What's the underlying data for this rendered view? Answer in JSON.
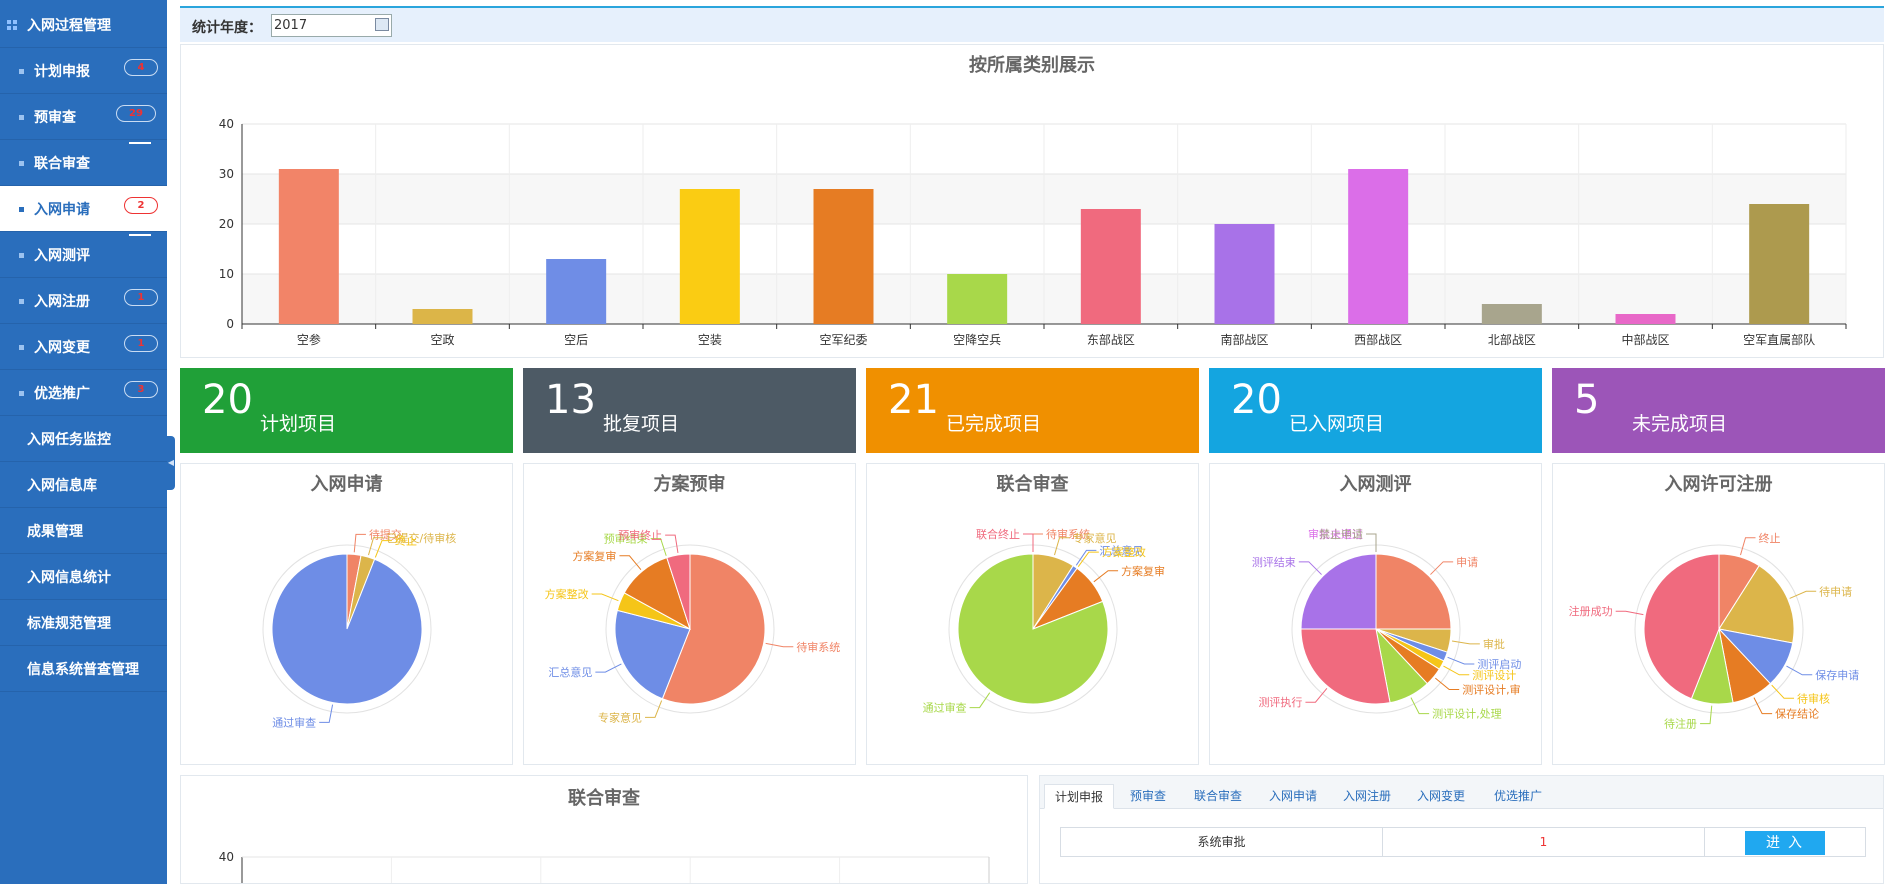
{
  "sidebar": {
    "items": [
      {
        "label": "入网过程管理",
        "kind": "top",
        "icon": "grid-icon"
      },
      {
        "label": "计划申报",
        "kind": "sub",
        "badge": "4"
      },
      {
        "label": "预审查",
        "kind": "sub",
        "badge": "29"
      },
      {
        "label": "联合审查",
        "kind": "sub",
        "badge": ""
      },
      {
        "label": "入网申请",
        "kind": "sub",
        "badge": "2",
        "active": true
      },
      {
        "label": "入网测评",
        "kind": "sub",
        "badge": ""
      },
      {
        "label": "入网注册",
        "kind": "sub",
        "badge": "1"
      },
      {
        "label": "入网变更",
        "kind": "sub",
        "badge": "1"
      },
      {
        "label": "优选推广",
        "kind": "sub",
        "badge": "3"
      },
      {
        "label": "入网任务监控",
        "kind": "top"
      },
      {
        "label": "入网信息库",
        "kind": "top"
      },
      {
        "label": "成果管理",
        "kind": "top"
      },
      {
        "label": "入网信息统计",
        "kind": "top"
      },
      {
        "label": "标准规范管理",
        "kind": "top"
      },
      {
        "label": "信息系统普查管理",
        "kind": "top"
      }
    ]
  },
  "filter": {
    "year_label": "统计年度：",
    "year_value": "2017"
  },
  "bar_chart_title": "按所属类别展示",
  "stats": [
    {
      "num": "20",
      "label": "计划项目",
      "color": "#20a038"
    },
    {
      "num": "13",
      "label": "批复项目",
      "color": "#4d5a65"
    },
    {
      "num": "21",
      "label": "已完成项目",
      "color": "#f09000"
    },
    {
      "num": "20",
      "label": "已入网项目",
      "color": "#14a5e0"
    },
    {
      "num": "5",
      "label": "未完成项目",
      "color": "#9c55b8"
    }
  ],
  "bottom_chart_title": "联合审查",
  "tabs": [
    "计划申报",
    "预审查",
    "联合审查",
    "入网申请",
    "入网注册",
    "入网变更",
    "优选推广"
  ],
  "table_row": {
    "name": "系统审批",
    "count": "1",
    "action": "进入"
  },
  "chart_data": [
    {
      "type": "bar",
      "title": "按所属类别展示",
      "categories": [
        "空参",
        "空政",
        "空后",
        "空装",
        "空军纪委",
        "空降空兵",
        "东部战区",
        "南部战区",
        "西部战区",
        "北部战区",
        "中部战区",
        "空军直属部队"
      ],
      "values": [
        31,
        3,
        13,
        27,
        27,
        10,
        23,
        20,
        31,
        4,
        2,
        24
      ],
      "colors": [
        "#f28468",
        "#dcb548",
        "#6f8de6",
        "#facc13",
        "#e67c23",
        "#a8d84a",
        "#f06a7e",
        "#a872e8",
        "#db6ee8",
        "#a8a58d",
        "#e868c8",
        "#ad9a4e"
      ],
      "ylim": [
        0,
        40
      ],
      "yticks": [
        0,
        10,
        20,
        30,
        40
      ]
    },
    {
      "type": "pie",
      "title": "入网申请",
      "slices": [
        {
          "label": "待提交",
          "value": 3,
          "color": "#f08466"
        },
        {
          "label": "已提交/待审核",
          "value": 3,
          "color": "#dcb54a"
        },
        {
          "label": "终止",
          "value": 0,
          "color": "#f5c518"
        },
        {
          "label": "通过审查",
          "value": 94,
          "color": "#6e8de6"
        }
      ]
    },
    {
      "type": "pie",
      "title": "方案预审",
      "slices": [
        {
          "label": "待审系统",
          "value": 56,
          "color": "#f08466"
        },
        {
          "label": "专家意见",
          "value": 0,
          "color": "#dcb54a"
        },
        {
          "label": "汇总意见",
          "value": 23,
          "color": "#6e8de6"
        },
        {
          "label": "方案整改",
          "value": 4,
          "color": "#f5c518"
        },
        {
          "label": "方案复审",
          "value": 12,
          "color": "#e67c23"
        },
        {
          "label": "预审结束",
          "value": 0,
          "color": "#a8d84a"
        },
        {
          "label": "预审终止",
          "value": 5,
          "color": "#f06a7e"
        }
      ]
    },
    {
      "type": "pie",
      "title": "联合审查",
      "slices": [
        {
          "label": "待审系统",
          "value": 0,
          "color": "#f08466"
        },
        {
          "label": "专家意见",
          "value": 9,
          "color": "#dcb54a"
        },
        {
          "label": "汇总意见",
          "value": 1,
          "color": "#6e8de6"
        },
        {
          "label": "方案整改",
          "value": 0,
          "color": "#f5c518"
        },
        {
          "label": "方案复审",
          "value": 9,
          "color": "#e67c23"
        },
        {
          "label": "通过审查",
          "value": 81,
          "color": "#a8d84a"
        },
        {
          "label": "联合终止",
          "value": 0,
          "color": "#f06a7e"
        }
      ]
    },
    {
      "type": "pie",
      "title": "入网测评",
      "slices": [
        {
          "label": "申请",
          "value": 25,
          "color": "#f08466"
        },
        {
          "label": "审批",
          "value": 5,
          "color": "#dcb54a"
        },
        {
          "label": "测评启动",
          "value": 2,
          "color": "#6e8de6"
        },
        {
          "label": "测评设计",
          "value": 2,
          "color": "#f5c518"
        },
        {
          "label": "测评设计,审",
          "value": 4,
          "color": "#e67c23"
        },
        {
          "label": "测评设计,处理",
          "value": 9,
          "color": "#a8d84a"
        },
        {
          "label": "测评执行",
          "value": 28,
          "color": "#f06a7e"
        },
        {
          "label": "测评结束",
          "value": 25,
          "color": "#a872e8"
        },
        {
          "label": "审批未通过",
          "value": 0,
          "color": "#db6ee8"
        },
        {
          "label": "禁止申请",
          "value": 0,
          "color": "#a8a58d"
        }
      ]
    },
    {
      "type": "pie",
      "title": "入网许可注册",
      "slices": [
        {
          "label": "终止",
          "value": 9,
          "color": "#f08466"
        },
        {
          "label": "待申请",
          "value": 19,
          "color": "#dcb54a"
        },
        {
          "label": "保存申请",
          "value": 10,
          "color": "#6e8de6"
        },
        {
          "label": "待审核",
          "value": 0,
          "color": "#f5c518"
        },
        {
          "label": "保存结论",
          "value": 9,
          "color": "#e67c23"
        },
        {
          "label": "待注册",
          "value": 9,
          "color": "#a8d84a"
        },
        {
          "label": "注册成功",
          "value": 44,
          "color": "#f06a7e"
        }
      ]
    },
    {
      "type": "bar",
      "title": "联合审查",
      "categories": [],
      "values": [],
      "ylim": [
        0,
        40
      ],
      "yticks": [
        40
      ]
    }
  ]
}
